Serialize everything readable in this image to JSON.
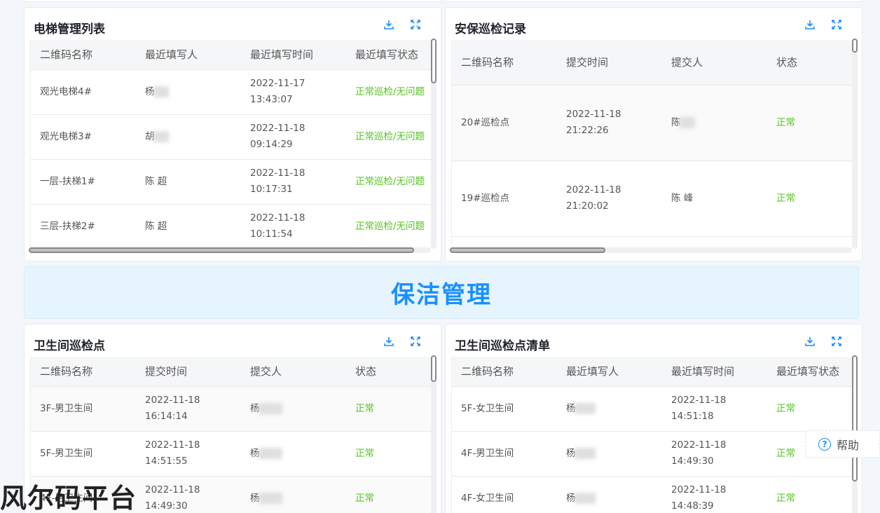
{
  "cards": {
    "elevator": {
      "title": "电梯管理列表",
      "headers": [
        "二维码名称",
        "最近填写人",
        "最近填写时间",
        "最近填写状态"
      ],
      "rows": [
        {
          "name": "观光电梯4#",
          "person": "杨",
          "date": "2022-11-17",
          "time": "13:43:07",
          "status": "正常巡检/无问题"
        },
        {
          "name": "观光电梯3#",
          "person": "胡",
          "date": "2022-11-18",
          "time": "09:14:29",
          "status": "正常巡检/无问题"
        },
        {
          "name": "一层-扶梯1#",
          "person": "陈 超",
          "date": "2022-11-18",
          "time": "10:17:31",
          "status": "正常巡检/无问题"
        },
        {
          "name": "三层-扶梯2#",
          "person": "陈 超",
          "date": "2022-11-18",
          "time": "10:11:54",
          "status": "正常巡检/无问题"
        }
      ]
    },
    "security": {
      "title": "安保巡检记录",
      "headers": [
        "二维码名称",
        "提交时间",
        "提交人",
        "状态"
      ],
      "rows": [
        {
          "name": "20#巡检点",
          "date": "2022-11-18",
          "time": "21:22:26",
          "person": "陈",
          "status": "正常"
        },
        {
          "name": "19#巡检点",
          "date": "2022-11-18",
          "time": "21:20:02",
          "person": "陈 峰",
          "status": "正常"
        }
      ]
    },
    "restroom_points": {
      "title": "卫生间巡检点",
      "headers": [
        "二维码名称",
        "提交时间",
        "提交人",
        "状态"
      ],
      "rows": [
        {
          "name": "3F-男卫生间",
          "date": "2022-11-18",
          "time": "16:14:14",
          "person": "杨",
          "status": "正常"
        },
        {
          "name": "5F-男卫生间",
          "date": "2022-11-18",
          "time": "14:51:55",
          "person": "杨",
          "status": "正常"
        },
        {
          "name": "4F-男卫生间",
          "date": "2022-11-18",
          "time": "14:49:30",
          "person": "杨",
          "status": "正常"
        }
      ]
    },
    "restroom_list": {
      "title": "卫生间巡检点清单",
      "headers": [
        "二维码名称",
        "最近填写人",
        "最近填写时间",
        "最近填写状态"
      ],
      "rows": [
        {
          "name": "5F-女卫生间",
          "person": "杨",
          "date": "2022-11-18",
          "time": "14:51:18",
          "status": "正常"
        },
        {
          "name": "4F-男卫生间",
          "person": "杨",
          "date": "2022-11-18",
          "time": "14:49:30",
          "status": "正常"
        },
        {
          "name": "4F-女卫生间",
          "person": "杨",
          "date": "2022-11-18",
          "time": "14:48:39",
          "status": "正常"
        }
      ]
    }
  },
  "banner": {
    "title": "保洁管理"
  },
  "help": {
    "label": "帮助"
  },
  "watermark": {
    "text": "风尔码平台"
  },
  "icons": {
    "download": "download-icon",
    "fullscreen": "fullscreen-icon",
    "help": "help-circle-icon"
  },
  "colors": {
    "accent": "#1890ff",
    "status_ok": "#52c41a"
  }
}
